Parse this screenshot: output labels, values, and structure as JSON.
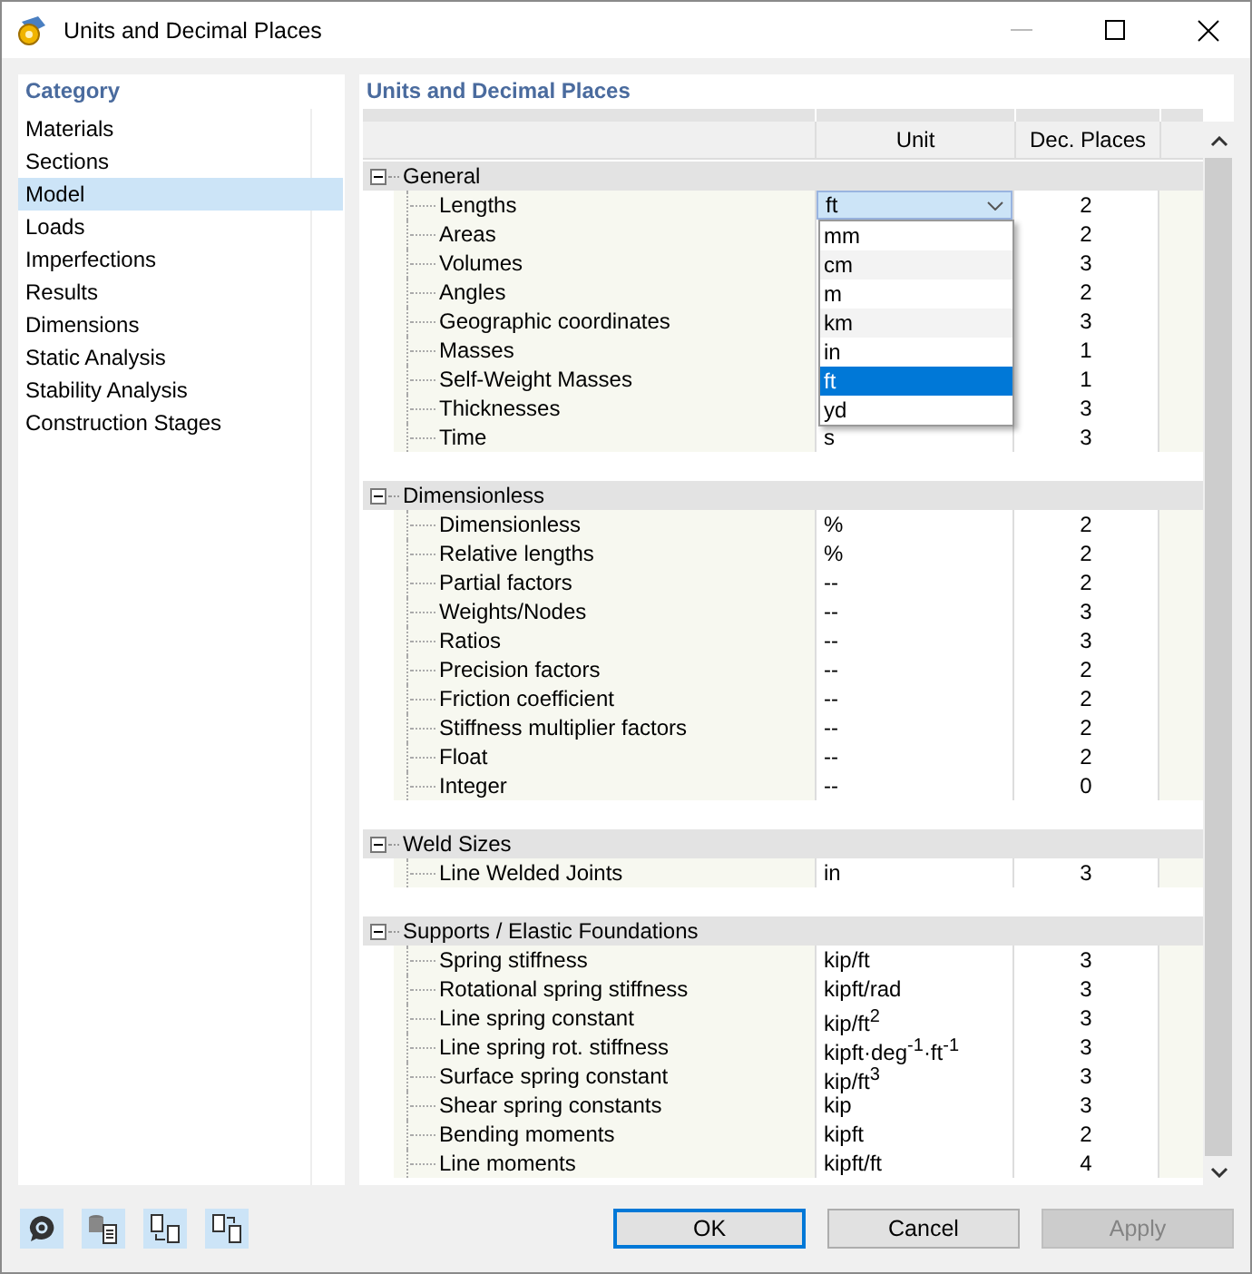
{
  "window": {
    "title": "Units and Decimal Places"
  },
  "sidebar": {
    "title": "Category",
    "items": [
      {
        "label": "Materials",
        "selected": false
      },
      {
        "label": "Sections",
        "selected": false
      },
      {
        "label": "Model",
        "selected": true
      },
      {
        "label": "Loads",
        "selected": false
      },
      {
        "label": "Imperfections",
        "selected": false
      },
      {
        "label": "Results",
        "selected": false
      },
      {
        "label": "Dimensions",
        "selected": false
      },
      {
        "label": "Static Analysis",
        "selected": false
      },
      {
        "label": "Stability Analysis",
        "selected": false
      },
      {
        "label": "Construction Stages",
        "selected": false
      }
    ]
  },
  "panel": {
    "title": "Units and Decimal Places",
    "columns": [
      "Unit",
      "Dec. Places"
    ],
    "groups": [
      {
        "name": "General",
        "expanded": true,
        "rows": [
          {
            "name": "Lengths",
            "decimals": "2",
            "dropdown": {
              "value": "ft",
              "open": true,
              "options": [
                {
                  "label": "mm",
                  "selected": false
                },
                {
                  "label": "cm",
                  "selected": false
                },
                {
                  "label": "m",
                  "selected": false
                },
                {
                  "label": "km",
                  "selected": false
                },
                {
                  "label": "in",
                  "selected": false
                },
                {
                  "label": "ft",
                  "selected": true
                },
                {
                  "label": "yd",
                  "selected": false
                }
              ]
            }
          },
          {
            "name": "Areas",
            "decimals": "2"
          },
          {
            "name": "Volumes",
            "decimals": "3"
          },
          {
            "name": "Angles",
            "decimals": "2"
          },
          {
            "name": "Geographic coordinates",
            "decimals": "3"
          },
          {
            "name": "Masses",
            "decimals": "1"
          },
          {
            "name": "Self-Weight Masses",
            "decimals": "1"
          },
          {
            "name": "Thicknesses",
            "decimals": "3"
          },
          {
            "name": "Time",
            "unit": "s",
            "decimals": "3"
          }
        ]
      },
      {
        "name": "Dimensionless",
        "expanded": true,
        "rows": [
          {
            "name": "Dimensionless",
            "unit": "%",
            "decimals": "2"
          },
          {
            "name": "Relative lengths",
            "unit": "%",
            "decimals": "2"
          },
          {
            "name": "Partial factors",
            "unit": "--",
            "decimals": "2"
          },
          {
            "name": "Weights/Nodes",
            "unit": "--",
            "decimals": "3"
          },
          {
            "name": "Ratios",
            "unit": "--",
            "decimals": "3"
          },
          {
            "name": "Precision factors",
            "unit": "--",
            "decimals": "2"
          },
          {
            "name": "Friction coefficient",
            "unit": "--",
            "decimals": "2"
          },
          {
            "name": "Stiffness multiplier factors",
            "unit": "--",
            "decimals": "2"
          },
          {
            "name": "Float",
            "unit": "--",
            "decimals": "2"
          },
          {
            "name": "Integer",
            "unit": "--",
            "decimals": "0"
          }
        ]
      },
      {
        "name": "Weld Sizes",
        "expanded": true,
        "rows": [
          {
            "name": "Line Welded Joints",
            "unit": "in",
            "decimals": "3"
          }
        ]
      },
      {
        "name": "Supports / Elastic Foundations",
        "expanded": true,
        "rows": [
          {
            "name": "Spring stiffness",
            "unit": "kip/ft",
            "decimals": "3"
          },
          {
            "name": "Rotational spring stiffness",
            "unit": "kipft/rad",
            "decimals": "3"
          },
          {
            "name": "Line spring constant",
            "unit": "kip/ft$^{2}$",
            "decimals": "3"
          },
          {
            "name": "Line spring rot. stiffness",
            "unit": "kipft·deg$^{-1}$·ft$^{-1}$",
            "decimals": "3"
          },
          {
            "name": "Surface spring constant",
            "unit": "kip/ft$^{3}$",
            "decimals": "3"
          },
          {
            "name": "Shear spring constants",
            "unit": "kip",
            "decimals": "3"
          },
          {
            "name": "Bending moments",
            "unit": "kipft",
            "decimals": "2"
          },
          {
            "name": "Line moments",
            "unit": "kipft/ft",
            "decimals": "4"
          }
        ]
      }
    ]
  },
  "buttons": [
    {
      "label": "OK",
      "kind": "default",
      "disabled": false
    },
    {
      "label": "Cancel",
      "kind": "normal",
      "disabled": false
    },
    {
      "label": "Apply",
      "kind": "normal",
      "disabled": true
    }
  ]
}
